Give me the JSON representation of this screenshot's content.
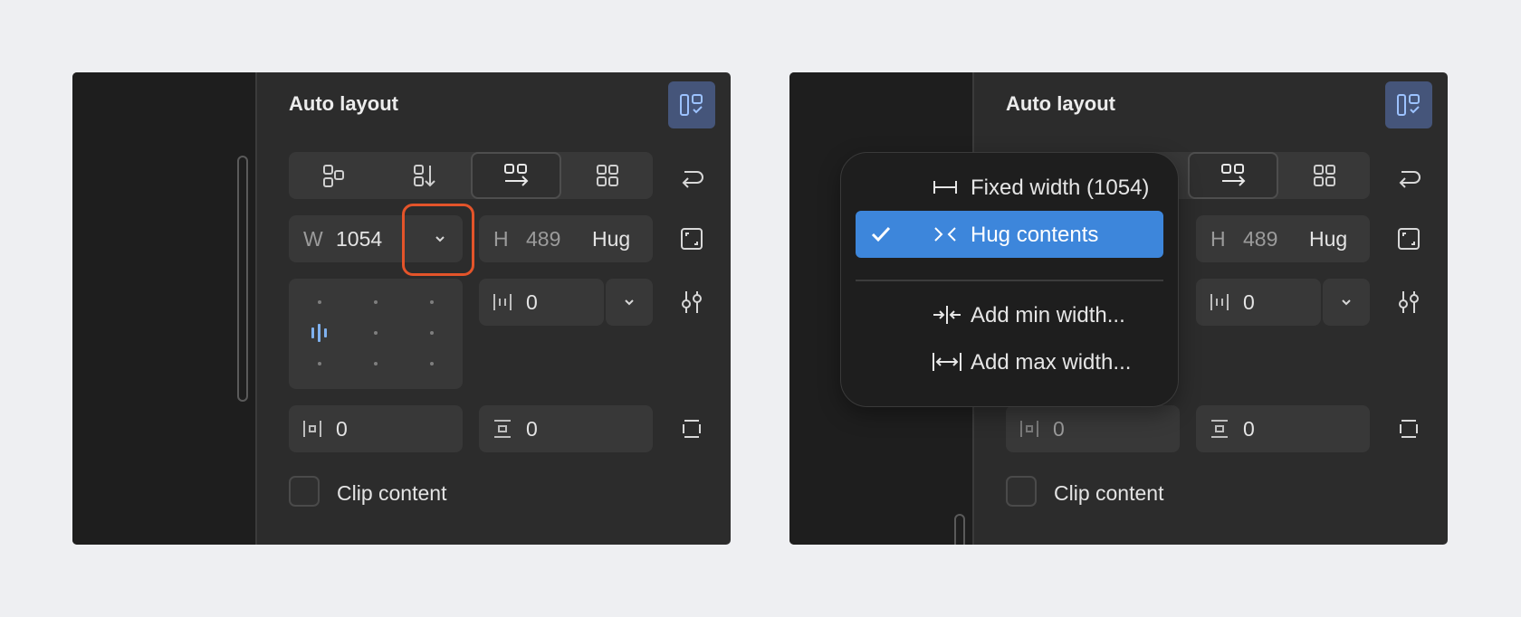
{
  "colors": {
    "background": "#eeeff2",
    "panel": "#2c2c2c",
    "strip": "#1e1e1e",
    "field": "#383838",
    "accent_blue": "#3d86db",
    "highlight_orange": "#e4542a",
    "layout_btn": "#45557a"
  },
  "panel": {
    "title": "Auto layout",
    "width": {
      "label": "W",
      "value": "1054"
    },
    "height": {
      "label": "H",
      "value": "489",
      "mode": "Hug"
    },
    "gap": {
      "value": "0"
    },
    "padding_h": {
      "value": "0"
    },
    "padding_v": {
      "value": "0"
    },
    "clip_content": {
      "label": "Clip content",
      "checked": false
    },
    "direction_selected": "horizontal"
  },
  "menu": {
    "items": [
      {
        "label": "Fixed width (1054)",
        "icon": "fixed-width-icon",
        "selected": false
      },
      {
        "label": "Hug contents",
        "icon": "hug-contents-icon",
        "selected": true
      },
      {
        "label": "Add min width...",
        "icon": "min-width-icon",
        "selected": false
      },
      {
        "label": "Add max width...",
        "icon": "max-width-icon",
        "selected": false
      }
    ]
  },
  "icons": [
    "layout-toggle-icon",
    "freeform-icon",
    "vertical-direction-icon",
    "horizontal-direction-icon",
    "grid-icon",
    "wrap-icon",
    "resize-icon",
    "settings-icon",
    "clip-icon",
    "chevron-down-icon",
    "check-icon"
  ]
}
